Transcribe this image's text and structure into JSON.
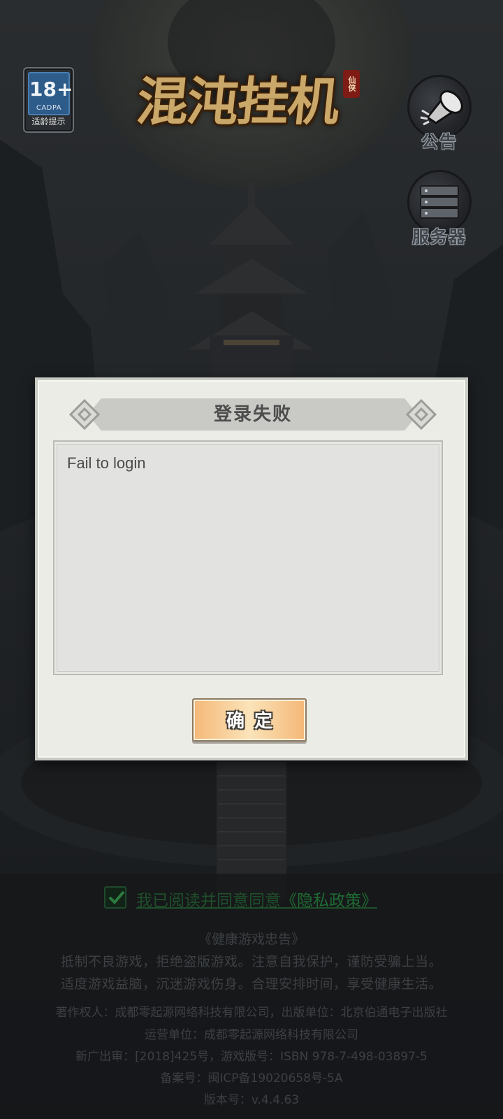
{
  "age_rating": {
    "number": "18+",
    "org": "CADPA",
    "tip": "适龄提示"
  },
  "logo": {
    "title": "混沌挂机",
    "seal": "仙侠"
  },
  "side_buttons": {
    "notice_label": "公告",
    "server_label": "服务器"
  },
  "dialog": {
    "title": "登录失败",
    "message": "Fail to login",
    "confirm_label": "确定"
  },
  "agreement": {
    "checked": true,
    "text": "我已阅读并同意同意",
    "link": "《隐私政策》"
  },
  "footer": {
    "health_title": "《健康游戏忠告》",
    "health_line1": "抵制不良游戏，拒绝盗版游戏。注意自我保护，谨防受骗上当。",
    "health_line2": "适度游戏益脑，沉迷游戏伤身。合理安排时间，享受健康生活。",
    "copyright": "著作权人：成都零起源网络科技有限公司，出版单位：北京伯通电子出版社",
    "operator": "运营单位：成都零起源网络科技有限公司",
    "approval": "新广出审：[2018]425号，游戏版号：ISBN 978-7-498-03897-5",
    "icp": "备案号：闽ICP备19020658号-5A",
    "version": "版本号：v.4.4.63"
  },
  "colors": {
    "background": "#1b1d1f",
    "dialog_bg": "#ecece7",
    "button_accent": "#f4b877",
    "agreement_green": "#1f4f2a"
  }
}
